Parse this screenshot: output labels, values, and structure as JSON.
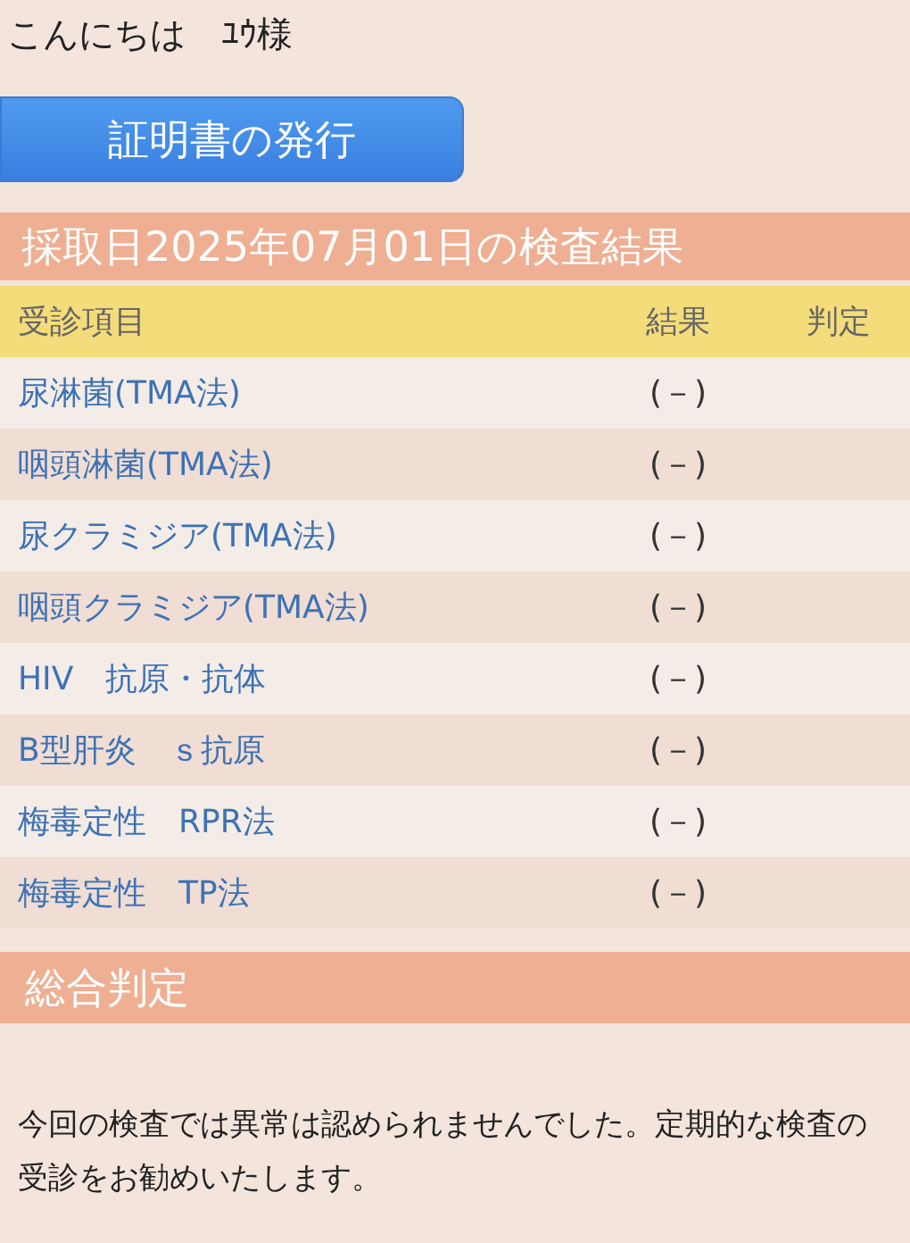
{
  "greeting": "こんにちは　ﾕｳ様",
  "certificate_button": "証明書の発行",
  "results_title": "採取日2025年07月01日の検査結果",
  "table": {
    "columns": [
      "受診項目",
      "結果",
      "判定"
    ],
    "rows": [
      {
        "item": "尿淋菌(TMA法)",
        "result": "(－)"
      },
      {
        "item": "咽頭淋菌(TMA法)",
        "result": "(－)"
      },
      {
        "item": "尿クラミジア(TMA法)",
        "result": "(－)"
      },
      {
        "item": "咽頭クラミジア(TMA法)",
        "result": "(－)"
      },
      {
        "item": "HIV　抗原・抗体",
        "result": "(－)"
      },
      {
        "item": "B型肝炎　ｓ抗原",
        "result": "(－)"
      },
      {
        "item": "梅毒定性　RPR法",
        "result": "(－)"
      },
      {
        "item": "梅毒定性　TP法",
        "result": "(－)"
      }
    ]
  },
  "overall_title": "総合判定",
  "overall_text": "今回の検査では異常は認められませんでした。定期的な検査の受診をお勧めいたします。"
}
